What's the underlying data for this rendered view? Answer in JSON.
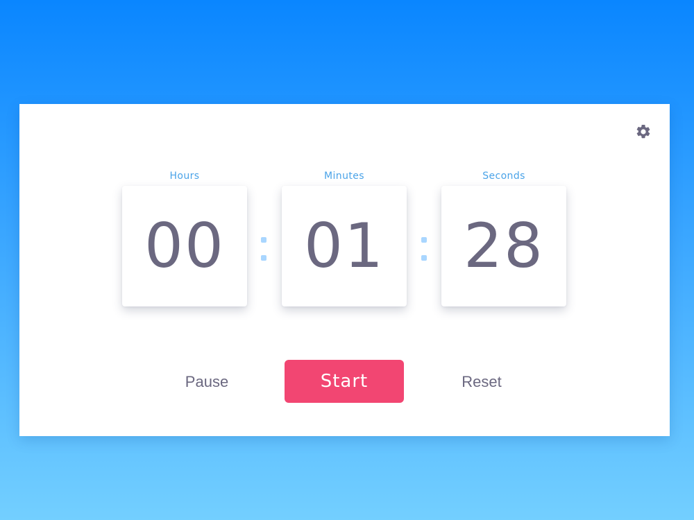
{
  "timer": {
    "hours": {
      "label": "Hours",
      "value": "00"
    },
    "minutes": {
      "label": "Minutes",
      "value": "01"
    },
    "seconds": {
      "label": "Seconds",
      "value": "28"
    }
  },
  "controls": {
    "pause_label": "Pause",
    "start_label": "Start",
    "reset_label": "Reset"
  },
  "icons": {
    "settings": "gear-icon"
  },
  "colors": {
    "background_top": "#0a86ff",
    "background_bottom": "#73cfff",
    "accent_label": "#4aa3e8",
    "digits": "#6b6880",
    "start_button": "#f24672",
    "separator_dots": "#a9d6ff"
  }
}
